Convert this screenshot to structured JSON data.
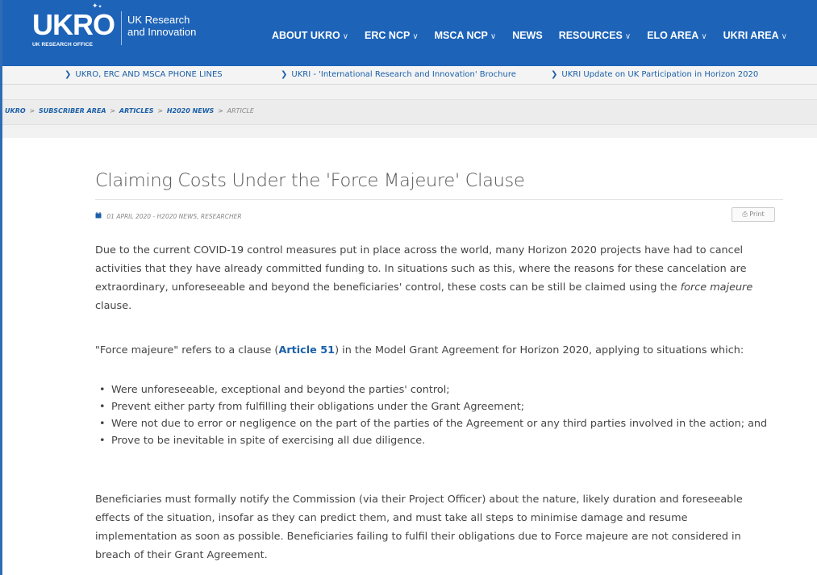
{
  "header": {
    "logo_text": "UKRO",
    "logo_subtext": "UK RESEARCH OFFICE",
    "partner_line1": "UK Research",
    "partner_line2": "and Innovation",
    "nav": [
      {
        "label": "ABOUT UKRO",
        "dropdown": true
      },
      {
        "label": "ERC NCP",
        "dropdown": true
      },
      {
        "label": "MSCA NCP",
        "dropdown": true
      },
      {
        "label": "NEWS",
        "dropdown": false
      },
      {
        "label": "RESOURCES",
        "dropdown": true
      },
      {
        "label": "ELO AREA",
        "dropdown": true
      },
      {
        "label": "UKRI AREA",
        "dropdown": true
      }
    ],
    "color": "#1d63b8"
  },
  "quicklinks": [
    "UKRO, ERC AND MSCA PHONE LINES",
    "UKRI - 'International Research and Innovation' Brochure",
    "UKRI Update on UK Participation in Horizon 2020"
  ],
  "breadcrumb": {
    "items": [
      "UKRO",
      "SUBSCRIBER AREA",
      "ARTICLES",
      "H2020 NEWS"
    ],
    "current": "ARTICLE",
    "separator": ">"
  },
  "article": {
    "title": "Claiming Costs Under the 'Force Majeure' Clause",
    "date": "01 APRIL 2020",
    "meta_separator": " - ",
    "categories": "H2020 NEWS, RESEARCHER",
    "print_label": "Print",
    "p1_text": "Due to the current COVID-19 control measures put in place across the world, many Horizon 2020 projects have had to cancel activities that they have already committed funding to. In situations such as this, where the reasons for these cancelation are extraordinary, unforeseeable and beyond the beneficiaries' control, these costs can be still be claimed using the ",
    "p1_emphasis": "force majeure",
    "p1_end": " clause.",
    "p2_start": "\"Force majeure\" refers to a clause (",
    "p2_link": "Article 51",
    "p2_end": ") in the Model Grant Agreement for Horizon 2020, applying to situations which:",
    "bullets": [
      "Were unforeseeable, exceptional and beyond the parties' control;",
      "Prevent either party from fulfilling their obligations under the Grant Agreement;",
      "Were not due to error or negligence on the part of the parties of the Agreement or any third parties involved in the action; and",
      "Prove to be inevitable in spite of exercising all due diligence."
    ],
    "p3": "Beneficiaries must formally notify the Commission (via their Project Officer) about the nature, likely duration and foreseeable effects of the situation, insofar as they can predict them, and must take all steps to minimise damage and resume implementation as soon as possible. Beneficiaries failing to fulfil their obligations due to Force majeure are not considered in breach of their Grant Agreement."
  },
  "icons": {
    "calendar": "calendar-icon",
    "print": "printer-icon",
    "chevron": "chevron-down-icon",
    "arrow": "chevron-right-icon"
  }
}
